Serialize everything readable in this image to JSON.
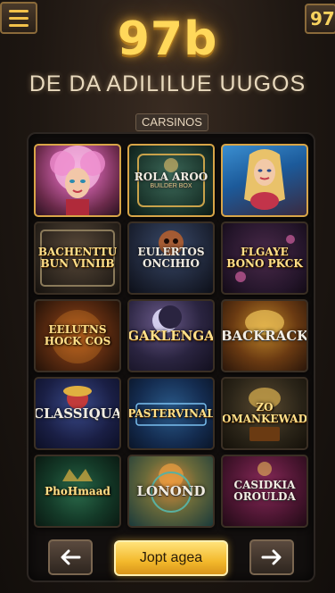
{
  "header": {
    "menu_icon": "hamburger-menu-icon",
    "logo_text": "97b",
    "badge_text": "97",
    "headline": "DE DA ADILILUE UUGOS"
  },
  "section": {
    "tab_label": "CARSINOS"
  },
  "games": [
    {
      "title": "",
      "subtitle": "",
      "art": "pink-haired-woman",
      "highlight": true
    },
    {
      "title": "ROLA AROO",
      "subtitle": "BUILDER BOX",
      "art": "green-slot",
      "highlight": true
    },
    {
      "title": "",
      "subtitle": "",
      "art": "blonde-mermaid",
      "highlight": true
    },
    {
      "title": "BACHENTTU BUN VINIIB",
      "subtitle": "",
      "art": "stone-slot",
      "highlight": false
    },
    {
      "title": "EULERTOS ONCIHIO",
      "subtitle": "",
      "art": "skull-character",
      "highlight": false
    },
    {
      "title": "FLGAYE BONO PKCK",
      "subtitle": "",
      "art": "pink-slot",
      "highlight": false
    },
    {
      "title": "EELUTNS HOCK COS",
      "subtitle": "",
      "art": "fire-slot",
      "highlight": false
    },
    {
      "title": "GAKLENGA",
      "subtitle": "",
      "art": "crescent-moon",
      "highlight": false
    },
    {
      "title": "BACKRACK",
      "subtitle": "",
      "art": "gold-treasure",
      "highlight": false
    },
    {
      "title": "CLASSIQUA",
      "subtitle": "",
      "art": "jester-slot",
      "highlight": false
    },
    {
      "title": "PASTERVINAL",
      "subtitle": "",
      "art": "blue-slot",
      "highlight": false
    },
    {
      "title": "ZO OMANKEWAD",
      "subtitle": "",
      "art": "treasure-chest",
      "highlight": false
    },
    {
      "title": "PhoHmaad",
      "subtitle": "",
      "art": "green-crown",
      "highlight": false
    },
    {
      "title": "LONOND",
      "subtitle": "",
      "art": "sun-machine",
      "highlight": false
    },
    {
      "title": "CASIDKIA OROULDA",
      "subtitle": "",
      "art": "magenta-slot",
      "highlight": false
    }
  ],
  "footer": {
    "prev_icon": "arrow-left-icon",
    "play_label": "Jopt agea",
    "next_icon": "arrow-right-icon"
  },
  "colors": {
    "accent_gold": "#f3b92c",
    "background": "#1e1712",
    "panel": "#120f0e"
  }
}
